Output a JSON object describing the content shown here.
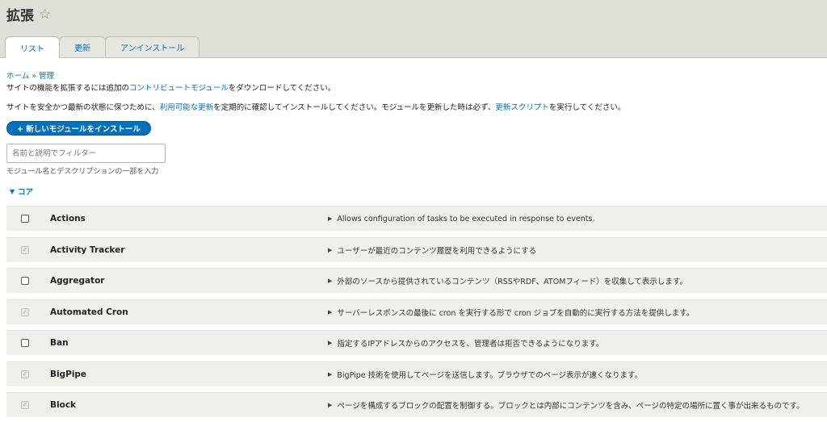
{
  "header": {
    "title": "拡張",
    "star_icon": "☆"
  },
  "tabs": [
    {
      "label": "リスト",
      "active": true
    },
    {
      "label": "更新",
      "active": false
    },
    {
      "label": "アンインストール",
      "active": false
    }
  ],
  "breadcrumb": {
    "home": "ホーム",
    "separator": " » ",
    "admin": "管理"
  },
  "description1": {
    "before": "サイトの機能を拡張するには追加の",
    "link": "コントリビュートモジュール",
    "after": "をダウンロードしてください。"
  },
  "description2": {
    "before": "サイトを安全かつ最新の状態に保つために、",
    "link1": "利用可能な更新",
    "middle": "を定期的に確認してインストールしてください。モジュールを更新した時は必ず、",
    "link2": "更新スクリプト",
    "after": "を実行してください。"
  },
  "install_button": "+ 新しいモジュールをインストール",
  "filter": {
    "placeholder": "名前と説明でフィルター",
    "hint": "モジュール名とデスクリプションの一部を入力"
  },
  "section": {
    "toggle_icon": "▼",
    "label": "コア"
  },
  "modules": [
    {
      "name": "Actions",
      "description": "Allows configuration of tasks to be executed in response to events.",
      "checked": false,
      "disabled": false
    },
    {
      "name": "Activity Tracker",
      "description": "ユーザーが最近のコンテンツ履歴を利用できるようにする",
      "checked": true,
      "disabled": true
    },
    {
      "name": "Aggregator",
      "description": "外部のソースから提供されているコンテンツ（RSSやRDF、ATOMフィード）を収集して表示します。",
      "checked": false,
      "disabled": false
    },
    {
      "name": "Automated Cron",
      "description": "サーバーレスポンスの最後に cron を実行する形で cron ジョブを自動的に実行する方法を提供します。",
      "checked": true,
      "disabled": true
    },
    {
      "name": "Ban",
      "description": "指定するIPアドレスからのアクセスを、管理者は拒否できるようになります。",
      "checked": false,
      "disabled": false
    },
    {
      "name": "BigPipe",
      "description": "BigPipe 技術を使用してページを送信します。ブラウザでのページ表示が速くなります。",
      "checked": true,
      "disabled": true
    },
    {
      "name": "Block",
      "description": "ページを構成するブロックの配置を制御する。ブロックとは内部にコンテンツを含み、ページの特定の場所に置く事が出来るものです。",
      "checked": true,
      "disabled": true
    }
  ],
  "colors": {
    "link": "#0074bd",
    "button": "#0071b8",
    "header_bg": "#e0e0d8",
    "row_bg": "#f0f0ea"
  }
}
